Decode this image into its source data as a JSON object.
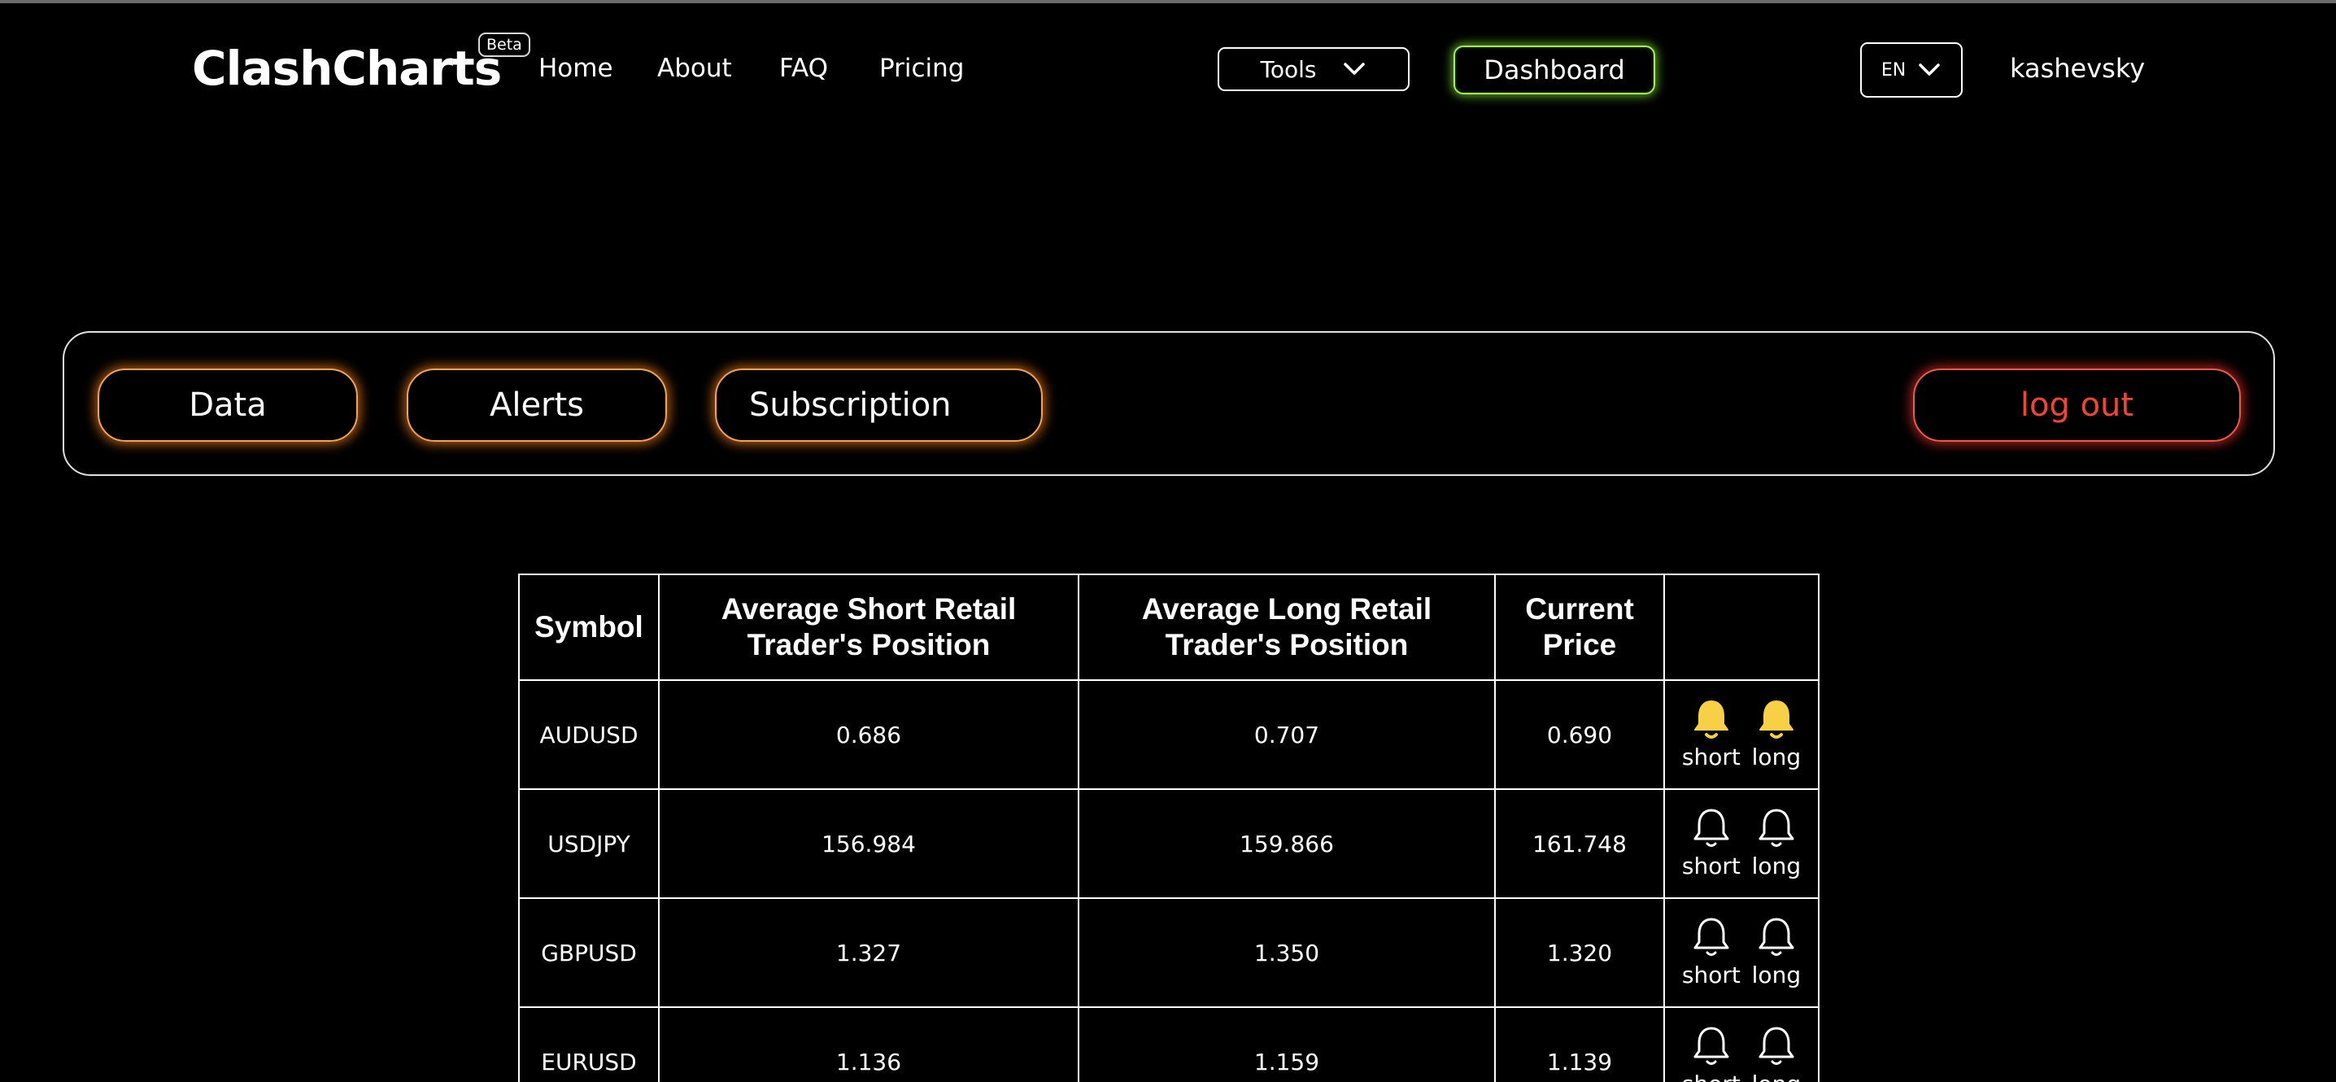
{
  "header": {
    "logo": "ClashCharts",
    "badge": "Beta",
    "nav": [
      {
        "label": "Home"
      },
      {
        "label": "About"
      },
      {
        "label": "FAQ"
      },
      {
        "label": "Pricing"
      }
    ],
    "tools_label": "Tools",
    "dashboard_label": "Dashboard",
    "language": "EN",
    "username": "kashevsky"
  },
  "panel": {
    "data_label": "Data",
    "alerts_label": "Alerts",
    "subscription_label": "Subscription",
    "logout_label": "log out"
  },
  "table": {
    "headers": [
      "Symbol",
      "Average Short Retail Trader's Position",
      "Average Long Retail Trader's Position",
      "Current Price",
      ""
    ],
    "alert_short_label": "short",
    "alert_long_label": "long",
    "rows": [
      {
        "symbol": "AUDUSD",
        "avg_short": "0.686",
        "avg_long": "0.707",
        "price": "0.690",
        "short_alert_active": true,
        "long_alert_active": true
      },
      {
        "symbol": "USDJPY",
        "avg_short": "156.984",
        "avg_long": "159.866",
        "price": "161.748",
        "short_alert_active": false,
        "long_alert_active": false
      },
      {
        "symbol": "GBPUSD",
        "avg_short": "1.327",
        "avg_long": "1.350",
        "price": "1.320",
        "short_alert_active": false,
        "long_alert_active": false
      },
      {
        "symbol": "EURUSD",
        "avg_short": "1.136",
        "avg_long": "1.159",
        "price": "1.139",
        "short_alert_active": false,
        "long_alert_active": false
      }
    ]
  },
  "colors": {
    "background": "#000000",
    "dashboard_glow": "#7ee634",
    "pill_glow": "#e87818",
    "logout": "#ee4535",
    "bell_active": "#f7d046",
    "bell_inactive": "#ffffff"
  },
  "icons": {
    "tools_caret": "chevron-down-icon",
    "language_caret": "chevron-down-icon",
    "alert": "bell-icon"
  }
}
